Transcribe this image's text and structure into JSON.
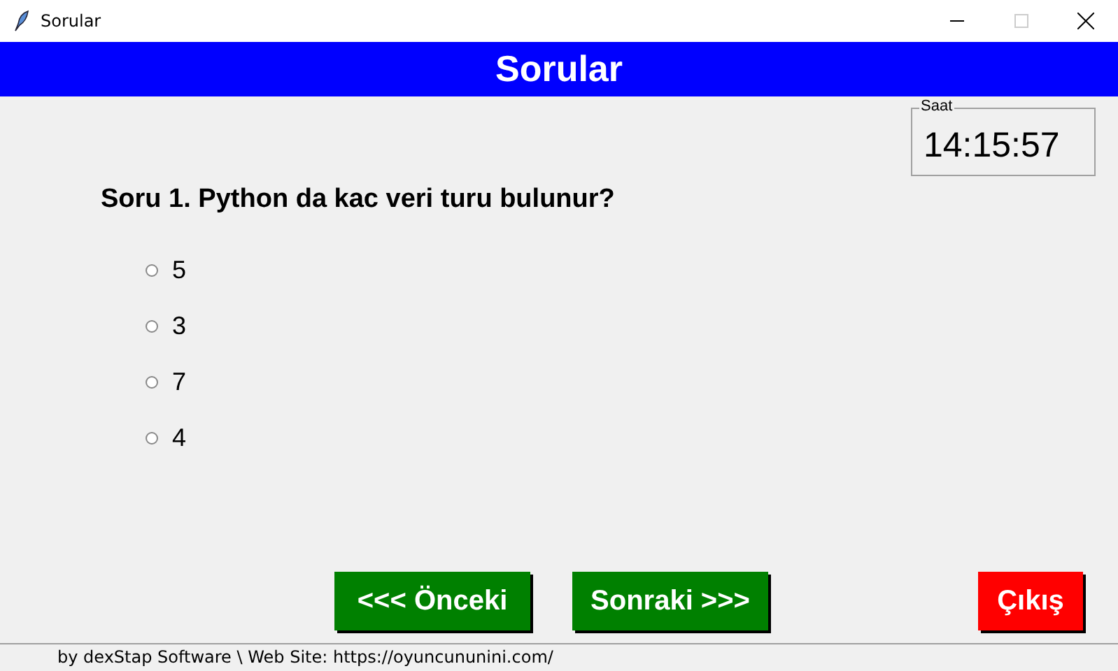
{
  "window": {
    "title": "Sorular"
  },
  "header": {
    "title": "Sorular"
  },
  "clock": {
    "label": "Saat",
    "time": "14:15:57"
  },
  "question": {
    "text": "Soru 1. Python da kac veri turu bulunur?"
  },
  "options": [
    {
      "label": "5",
      "selected": false
    },
    {
      "label": "3",
      "selected": false
    },
    {
      "label": "7",
      "selected": false
    },
    {
      "label": "4",
      "selected": false
    }
  ],
  "buttons": [
    {
      "label": "<<< Önceki",
      "color": "#008000"
    },
    {
      "label": "Sonraki >>>",
      "color": "#008000"
    },
    {
      "label": "Çıkış",
      "color": "#ff0000"
    }
  ],
  "status_bar": {
    "text": "by dexStap Software \\ Web Site: https://oyuncununini.com/"
  }
}
